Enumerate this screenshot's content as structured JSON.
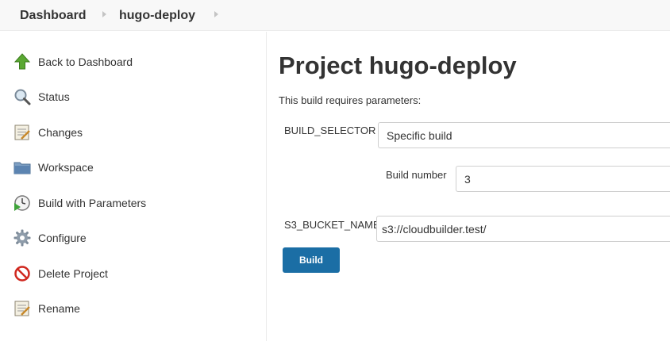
{
  "breadcrumb": {
    "items": [
      "Dashboard",
      "hugo-deploy"
    ]
  },
  "sidebar": {
    "items": [
      {
        "label": "Back to Dashboard",
        "icon": "up-arrow-icon"
      },
      {
        "label": "Status",
        "icon": "magnifier-icon"
      },
      {
        "label": "Changes",
        "icon": "notepad-icon"
      },
      {
        "label": "Workspace",
        "icon": "folder-icon"
      },
      {
        "label": "Build with Parameters",
        "icon": "clock-play-icon"
      },
      {
        "label": "Configure",
        "icon": "gear-icon"
      },
      {
        "label": "Delete Project",
        "icon": "no-entry-icon"
      },
      {
        "label": "Rename",
        "icon": "notepad-icon"
      }
    ]
  },
  "main": {
    "title": "Project hugo-deploy",
    "hint": "This build requires parameters:",
    "params": {
      "build_selector": {
        "label": "BUILD_SELECTOR",
        "value": "Specific build"
      },
      "build_number": {
        "label": "Build number",
        "value": "3"
      },
      "s3_bucket": {
        "label": "S3_BUCKET_NAME",
        "value": "s3://cloudbuilder.test/"
      }
    },
    "build_button": "Build"
  },
  "colors": {
    "accent": "#1b6ea5",
    "sidebar_border": "#ebebeb"
  }
}
